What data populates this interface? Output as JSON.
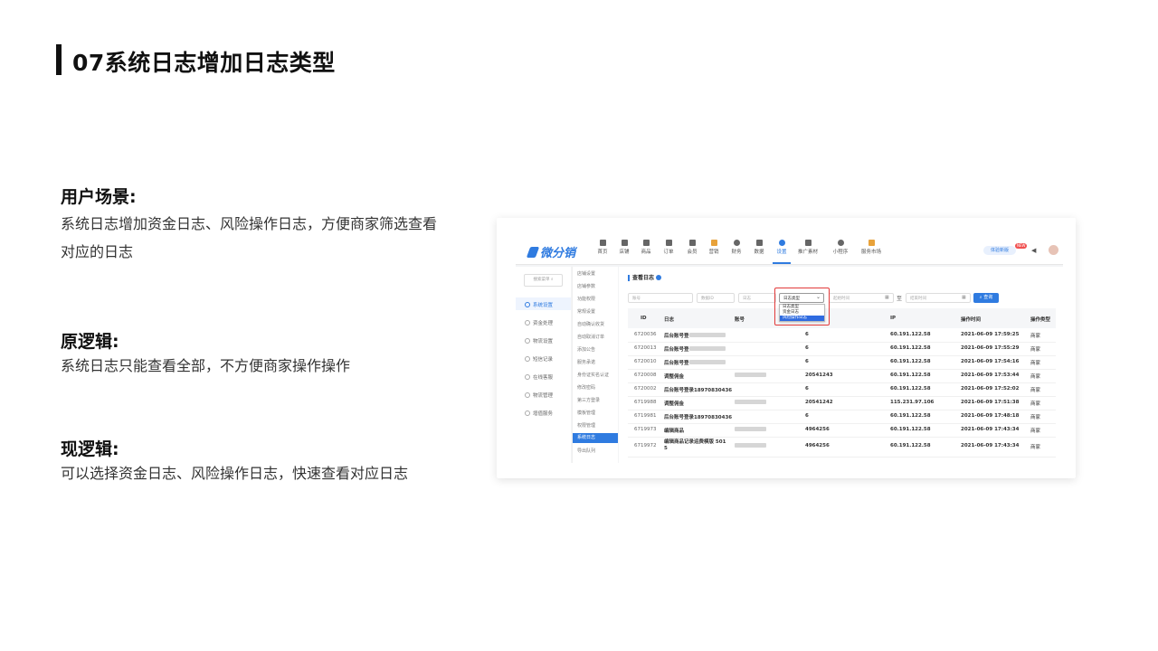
{
  "slide": {
    "title": "07系统日志增加日志类型",
    "sections": [
      {
        "heading": "用户场景:",
        "text": "系统日志增加资金日志、风险操作日志，方便商家筛选查看对应的日志"
      },
      {
        "heading": "原逻辑:",
        "text": "系统日志只能查看全部，不方便商家操作操作"
      },
      {
        "heading": "现逻辑:",
        "text": "可以选择资金日志、风险操作日志，快速查看对应日志"
      }
    ]
  },
  "app": {
    "logo": "微分销",
    "nav": [
      "首页",
      "店铺",
      "商品",
      "订单",
      "会员",
      "营销",
      "财务",
      "数据",
      "设置",
      "推广素材",
      "小程序",
      "服务市场"
    ],
    "nav_active": "设置",
    "trial_button": "体验新版",
    "new_badge": "NEW",
    "side_search": "搜索菜单 ⌕",
    "side_primary": [
      "系统设置",
      "资金处理",
      "物流设置",
      "短信记录",
      "在线客服",
      "物流管理",
      "增值服务"
    ],
    "side_primary_active": "系统设置",
    "side_secondary": [
      "店铺设置",
      "店铺参数",
      "功能权限",
      "常规设置",
      "自动确认收货",
      "自动取消订单",
      "添加公告",
      "服务承诺",
      "身份证实名认证",
      "修改密码",
      "第三方登录",
      "模板管理",
      "权限管理",
      "系统日志",
      "导出队列"
    ],
    "side_secondary_active": "系统日志",
    "page_title": "查看日志",
    "filters": {
      "account_placeholder": "账号",
      "data_id_placeholder": "数据ID",
      "log_placeholder": "日志",
      "log_type_selected": "日志类型",
      "start_time_placeholder": "起始时间",
      "end_time_placeholder": "结束时间",
      "query_button": "查询",
      "range_sep": "至",
      "log_type_options": [
        "日志类型",
        "资金日志",
        "风险操作日志"
      ]
    },
    "table": {
      "headers": [
        "ID",
        "日志",
        "账号",
        "",
        "IP",
        "操作时间",
        "操作类型"
      ],
      "rows": [
        {
          "id": "6720036",
          "log": "后台账号登",
          "account": "",
          "data": "6",
          "ip": "60.191.122.58",
          "time": "2021-06-09 17:59:25",
          "type": "商家"
        },
        {
          "id": "6720013",
          "log": "后台账号登",
          "account": "",
          "data": "6",
          "ip": "60.191.122.58",
          "time": "2021-06-09 17:55:29",
          "type": "商家"
        },
        {
          "id": "6720010",
          "log": "后台账号登",
          "account": "",
          "data": "6",
          "ip": "60.191.122.58",
          "time": "2021-06-09 17:54:16",
          "type": "商家"
        },
        {
          "id": "6720008",
          "log": "调整佣金",
          "account": "",
          "data": "20541243",
          "ip": "60.191.122.58",
          "time": "2021-06-09 17:53:44",
          "type": "商家"
        },
        {
          "id": "6720002",
          "log": "后台账号登录18970830436",
          "account": "",
          "data": "6",
          "ip": "60.191.122.58",
          "time": "2021-06-09 17:52:02",
          "type": "商家"
        },
        {
          "id": "6719988",
          "log": "调整佣金",
          "account": "",
          "data": "20541242",
          "ip": "115.231.97.106",
          "time": "2021-06-09 17:51:38",
          "type": "商家"
        },
        {
          "id": "6719981",
          "log": "后台账号登录18970830436",
          "account": "",
          "data": "6",
          "ip": "60.191.122.58",
          "time": "2021-06-09 17:48:18",
          "type": "商家"
        },
        {
          "id": "6719973",
          "log": "编辑商品",
          "account": "",
          "data": "4964256",
          "ip": "60.191.122.58",
          "time": "2021-06-09 17:43:34",
          "type": "商家"
        },
        {
          "id": "6719972",
          "log": "编辑商品记录运费模版 501 5",
          "account": "",
          "data": "4964256",
          "ip": "60.191.122.58",
          "time": "2021-06-09 17:43:34",
          "type": "商家"
        }
      ]
    }
  }
}
